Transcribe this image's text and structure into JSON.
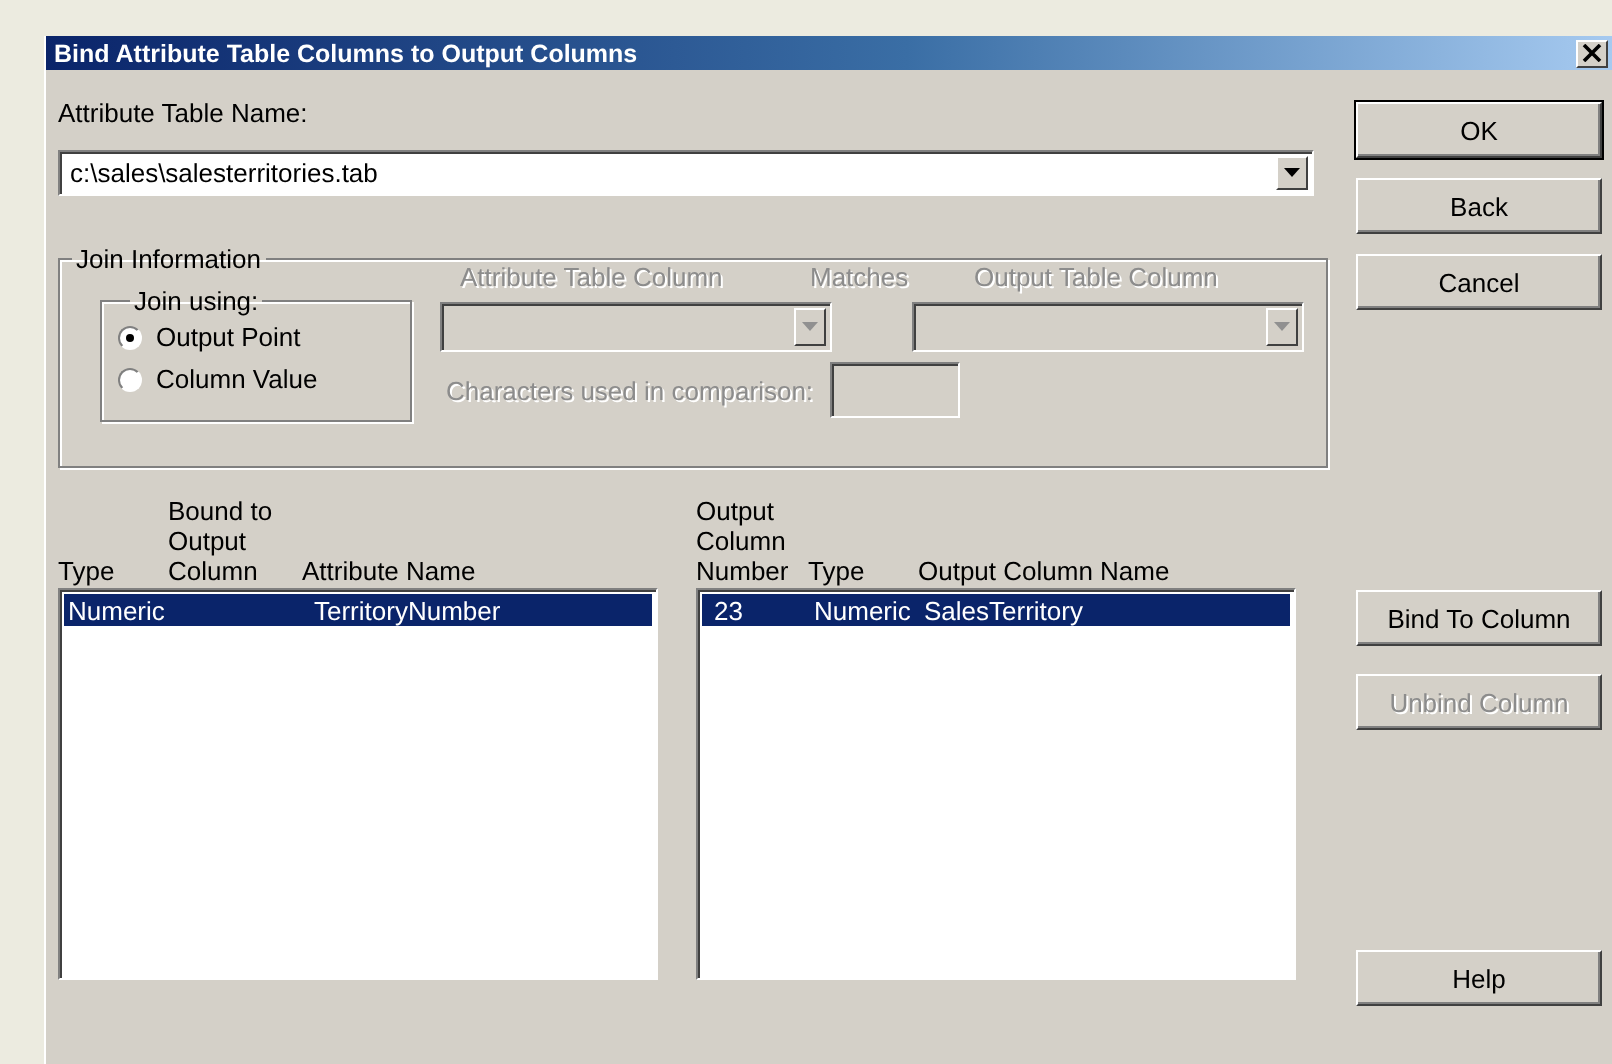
{
  "window": {
    "title": "Bind Attribute Table Columns to Output Columns"
  },
  "attribute_table": {
    "label": "Attribute Table Name:",
    "value": "c:\\sales\\salesterritories.tab"
  },
  "join_information": {
    "title": "Join Information",
    "join_using": {
      "title": "Join using:",
      "options": [
        {
          "label": "Output Point",
          "selected": true
        },
        {
          "label": "Column Value",
          "selected": false
        }
      ]
    },
    "attribute_table_column": {
      "label": "Attribute Table Column",
      "disabled": true
    },
    "matches_label": "Matches",
    "output_table_column": {
      "label": "Output Table Column",
      "disabled": true
    },
    "characters": {
      "label": "Characters used in comparison:",
      "disabled": true
    }
  },
  "attribute_list": {
    "columns": [
      "Type",
      "Bound to\nOutput\nColumn",
      "Attribute Name"
    ],
    "rows": [
      {
        "type": "Numeric",
        "attribute_name": "TerritoryNumber",
        "selected": true
      }
    ]
  },
  "output_list": {
    "columns": [
      "Output\nColumn\nNumber",
      "Type",
      "Output Column Name"
    ],
    "rows": [
      {
        "number": "23",
        "type": "Numeric",
        "name": "SalesTerritory",
        "selected": true
      }
    ]
  },
  "dialog_buttons": [
    {
      "label": "OK",
      "disabled": false
    },
    {
      "label": "Back",
      "disabled": false
    },
    {
      "label": "Cancel",
      "disabled": false
    }
  ],
  "binding_buttons": [
    {
      "label": "Bind To Column",
      "disabled": false
    },
    {
      "label": "Unbind Column",
      "disabled": true
    }
  ],
  "help_button": {
    "label": "Help",
    "disabled": false
  }
}
